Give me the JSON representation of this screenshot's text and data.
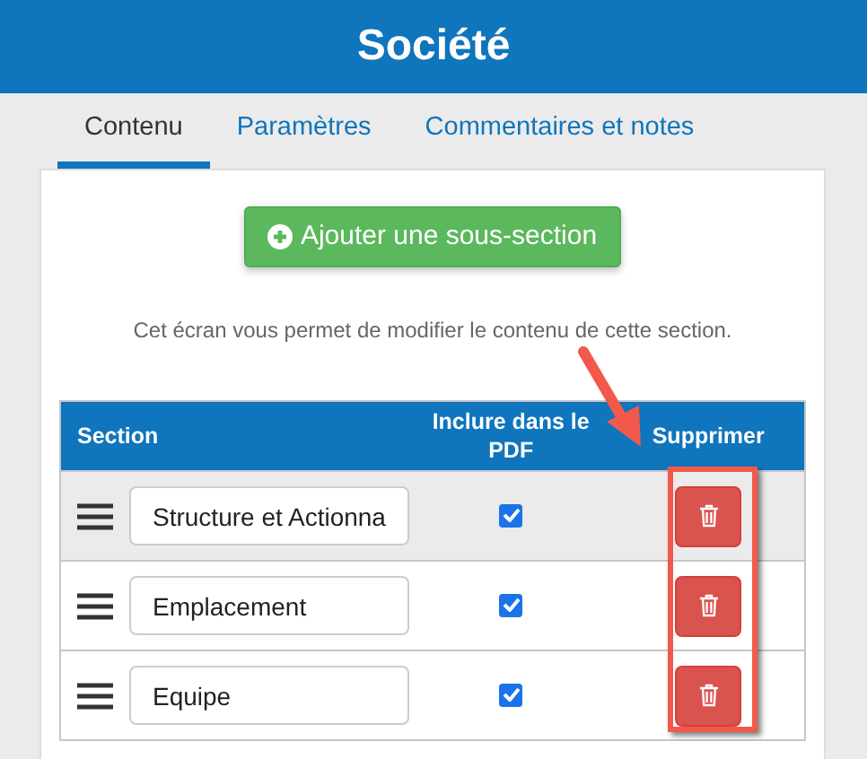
{
  "header": {
    "title": "Société"
  },
  "tabs": [
    {
      "label": "Contenu",
      "selected": true
    },
    {
      "label": "Paramètres",
      "selected": false
    },
    {
      "label": "Commentaires et notes",
      "selected": false
    }
  ],
  "add_button": {
    "label": "Ajouter une sous-section"
  },
  "description": "Cet écran vous permet de modifier le contenu de cette section.",
  "table": {
    "columns": [
      "Section",
      "Inclure dans le PDF",
      "Supprimer"
    ],
    "rows": [
      {
        "value": "Structure et Actionna",
        "include_in_pdf": true,
        "highlighted": true
      },
      {
        "value": "Emplacement",
        "include_in_pdf": true,
        "highlighted": false
      },
      {
        "value": "Equipe",
        "include_in_pdf": true,
        "highlighted": false
      }
    ]
  }
}
